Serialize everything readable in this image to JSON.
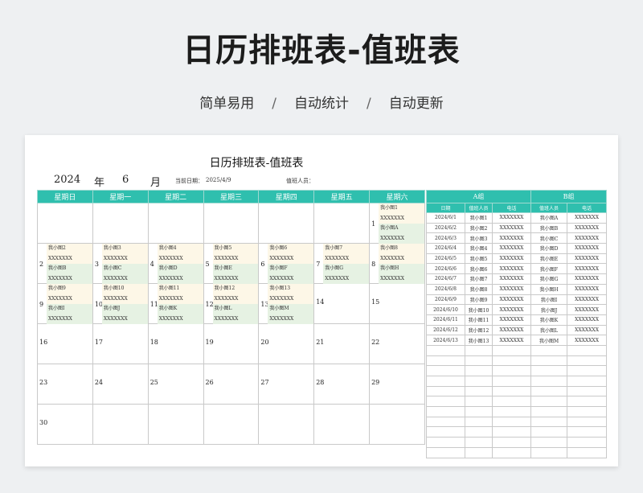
{
  "header": {
    "title": "日历排班表-值班表",
    "tags": [
      "简单易用",
      "自动统计",
      "自动更新"
    ],
    "separator": "/"
  },
  "sheet": {
    "title": "日历排班表-值班表",
    "year": "2024",
    "year_label": "年",
    "month": "6",
    "month_label": "月",
    "date_label": "当前日期：",
    "date_value": "2025/4/9",
    "staff_label": "值班人员："
  },
  "calendar": {
    "weekdays": [
      "星期日",
      "星期一",
      "星期二",
      "星期三",
      "星期四",
      "星期五",
      "星期六"
    ],
    "weeks": [
      [
        null,
        null,
        null,
        null,
        null,
        null,
        {
          "day": "1",
          "slots": [
            "我小图1",
            "XXXXXXX",
            "我小图A",
            "XXXXXXX"
          ]
        }
      ],
      [
        {
          "day": "2",
          "slots": [
            "我小图2",
            "XXXXXXX",
            "我小图B",
            "XXXXXXX"
          ]
        },
        {
          "day": "3",
          "slots": [
            "我小图3",
            "XXXXXXX",
            "我小图C",
            "XXXXXXX"
          ]
        },
        {
          "day": "4",
          "slots": [
            "我小图4",
            "XXXXXXX",
            "我小图D",
            "XXXXXXX"
          ]
        },
        {
          "day": "5",
          "slots": [
            "我小图5",
            "XXXXXXX",
            "我小图E",
            "XXXXXXX"
          ]
        },
        {
          "day": "6",
          "slots": [
            "我小图6",
            "XXXXXXX",
            "我小图F",
            "XXXXXXX"
          ]
        },
        {
          "day": "7",
          "slots": [
            "我小图7",
            "XXXXXXX",
            "我小图G",
            "XXXXXXX"
          ]
        },
        {
          "day": "8",
          "slots": [
            "我小图8",
            "XXXXXXX",
            "我小图H",
            "XXXXXXX"
          ]
        }
      ],
      [
        {
          "day": "9",
          "slots": [
            "我小图9",
            "XXXXXXX",
            "我小图I",
            "XXXXXXX"
          ]
        },
        {
          "day": "10",
          "slots": [
            "我小图10",
            "XXXXXXX",
            "我小图J",
            "XXXXXXX"
          ]
        },
        {
          "day": "11",
          "slots": [
            "我小图11",
            "XXXXXXX",
            "我小图K",
            "XXXXXXX"
          ]
        },
        {
          "day": "12",
          "slots": [
            "我小图12",
            "XXXXXXX",
            "我小图L",
            "XXXXXXX"
          ]
        },
        {
          "day": "13",
          "slots": [
            "我小图13",
            "XXXXXXX",
            "我小图M",
            "XXXXXXX"
          ]
        },
        {
          "day": "14",
          "slots": []
        },
        {
          "day": "15",
          "slots": []
        }
      ],
      [
        {
          "day": "16",
          "slots": []
        },
        {
          "day": "17",
          "slots": []
        },
        {
          "day": "18",
          "slots": []
        },
        {
          "day": "19",
          "slots": []
        },
        {
          "day": "20",
          "slots": []
        },
        {
          "day": "21",
          "slots": []
        },
        {
          "day": "22",
          "slots": []
        }
      ],
      [
        {
          "day": "23",
          "slots": []
        },
        {
          "day": "24",
          "slots": []
        },
        {
          "day": "25",
          "slots": []
        },
        {
          "day": "26",
          "slots": []
        },
        {
          "day": "27",
          "slots": []
        },
        {
          "day": "28",
          "slots": []
        },
        {
          "day": "29",
          "slots": []
        }
      ],
      [
        {
          "day": "30",
          "slots": []
        },
        null,
        null,
        null,
        null,
        null,
        null
      ]
    ]
  },
  "roster": {
    "group_a": "A组",
    "group_b": "B组",
    "columns": [
      "日期",
      "值班人员",
      "电话",
      "值班人员",
      "电话"
    ],
    "rows": [
      [
        "2024/6/1",
        "我小图1",
        "XXXXXXX",
        "我小图A",
        "XXXXXXX"
      ],
      [
        "2024/6/2",
        "我小图2",
        "XXXXXXX",
        "我小图B",
        "XXXXXXX"
      ],
      [
        "2024/6/3",
        "我小图3",
        "XXXXXXX",
        "我小图C",
        "XXXXXXX"
      ],
      [
        "2024/6/4",
        "我小图4",
        "XXXXXXX",
        "我小图D",
        "XXXXXXX"
      ],
      [
        "2024/6/5",
        "我小图5",
        "XXXXXXX",
        "我小图E",
        "XXXXXXX"
      ],
      [
        "2024/6/6",
        "我小图6",
        "XXXXXXX",
        "我小图F",
        "XXXXXXX"
      ],
      [
        "2024/6/7",
        "我小图7",
        "XXXXXXX",
        "我小图G",
        "XXXXXXX"
      ],
      [
        "2024/6/8",
        "我小图8",
        "XXXXXXX",
        "我小图H",
        "XXXXXXX"
      ],
      [
        "2024/6/9",
        "我小图9",
        "XXXXXXX",
        "我小图I",
        "XXXXXXX"
      ],
      [
        "2024/6/10",
        "我小图10",
        "XXXXXXX",
        "我小图J",
        "XXXXXXX"
      ],
      [
        "2024/6/11",
        "我小图11",
        "XXXXXXX",
        "我小图K",
        "XXXXXXX"
      ],
      [
        "2024/6/12",
        "我小图12",
        "XXXXXXX",
        "我小图L",
        "XXXXXXX"
      ],
      [
        "2024/6/13",
        "我小图13",
        "XXXXXXX",
        "我小图M",
        "XXXXXXX"
      ]
    ]
  },
  "colors": {
    "header_teal": "#2fbfae",
    "name_bg": "#fdf7e7",
    "alt_bg": "#e6f2e3"
  }
}
